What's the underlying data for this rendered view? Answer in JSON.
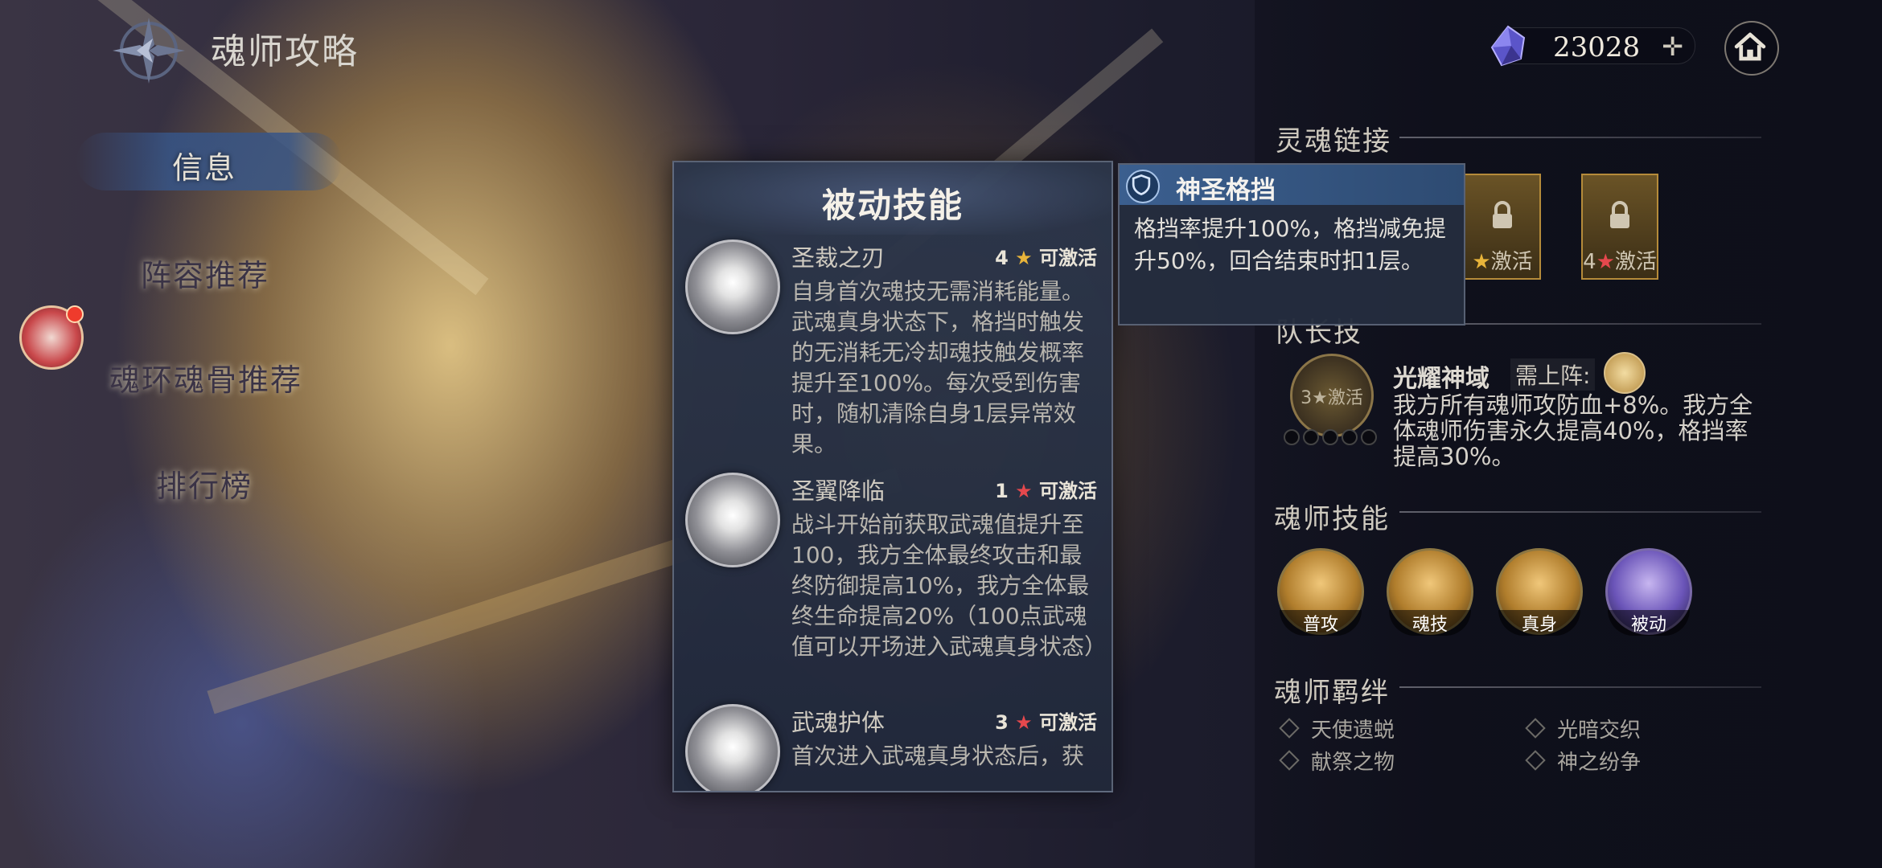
{
  "header": {
    "title": "魂师攻略",
    "currency_value": "23028",
    "currency_plus": "✛"
  },
  "nav": {
    "items": [
      "信息",
      "阵容推荐",
      "魂环魂骨推荐",
      "排行榜"
    ]
  },
  "panel": {
    "title": "被动技能",
    "skills": [
      {
        "name": "圣裁之刃",
        "req_num": "4",
        "req_star": "★",
        "req_text": "可激活",
        "desc": "自身首次魂技无需消耗能量。武魂真身状态下，格挡时触发的无消耗无冷却魂技触发概率提升至100%。每次受到伤害时，随机清除自身1层异常效果。"
      },
      {
        "name": "圣翼降临",
        "req_num": "1",
        "req_star": "★",
        "req_text": "可激活",
        "desc": "战斗开始前获取武魂值提升至100，我方全体最终攻击和最终防御提高10%，我方全体最终生命提高20%（100点武魂值可以开场进入武魂真身状态）"
      },
      {
        "name": "武魂护体",
        "req_num": "3",
        "req_star": "★",
        "req_text": "可激活",
        "desc": "首次进入武魂真身状态后，获"
      }
    ]
  },
  "tooltip": {
    "title": "神圣格挡",
    "desc": "格挡率提升100%，格挡减免提升50%，回合结束时扣1层。"
  },
  "soul_link": {
    "title": "灵魂链接",
    "cards": [
      {
        "num": "",
        "star": "★",
        "text": "激活"
      },
      {
        "num": "4",
        "star": "★",
        "text": "激活"
      }
    ]
  },
  "captain": {
    "title": "队长技",
    "icon_label": "3★激活",
    "name": "光耀神域",
    "need_label": "需上阵:",
    "desc": "我方所有魂师攻防血+8%。我方全体魂师伤害永久提高40%，格挡率提高30%。"
  },
  "skills": {
    "title": "魂师技能",
    "buttons": [
      "普攻",
      "魂技",
      "真身",
      "被动"
    ]
  },
  "bonds": {
    "title": "魂师羁绊",
    "items": [
      "天使遗蜕",
      "光暗交织",
      "献祭之物",
      "神之纷争"
    ]
  },
  "colors": {
    "gold": "#e8b43a",
    "red_star": "#e5484d",
    "panel": "#2c364a",
    "tooltip_head": "#3b5f8f"
  }
}
